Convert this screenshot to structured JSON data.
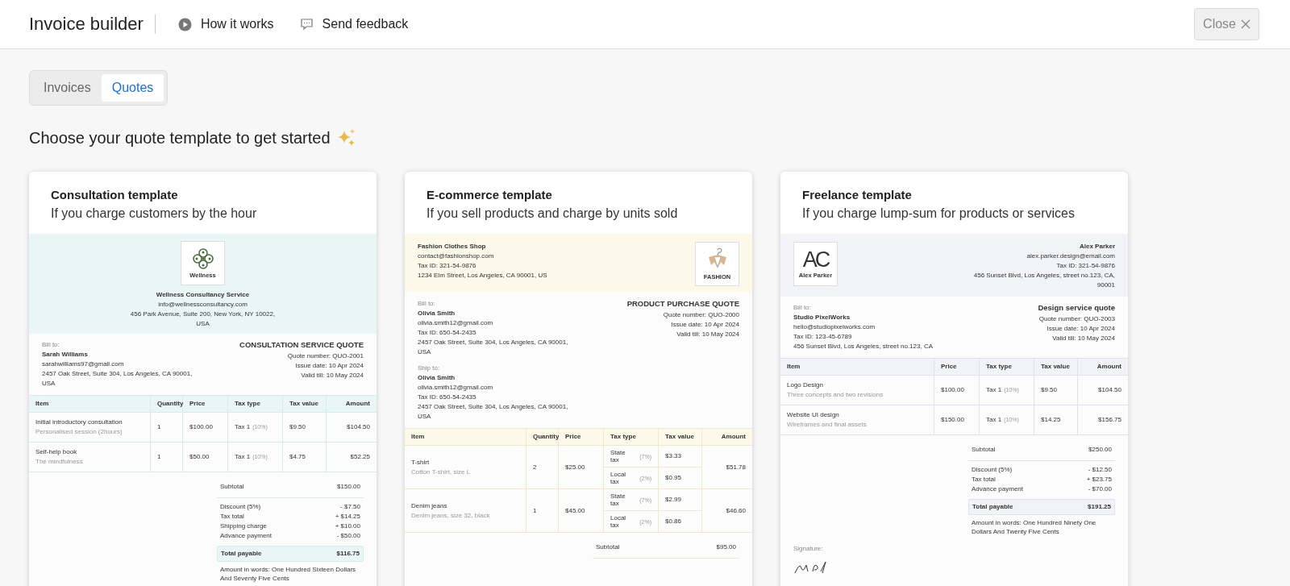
{
  "header": {
    "title": "Invoice builder",
    "links": [
      {
        "kind": "video",
        "label": "How it works"
      },
      {
        "kind": "feedback",
        "label": "Send feedback"
      }
    ],
    "close": "Close"
  },
  "tabs": [
    {
      "label": "Invoices",
      "selected": false
    },
    {
      "label": "Quotes",
      "selected": true
    }
  ],
  "heading": "Choose your quote template to get started",
  "templates": [
    {
      "kind": "consultation",
      "title": "Consultation template",
      "subtitle": "If you charge customers by the hour",
      "logo": {
        "label": "Wellness"
      },
      "sender": {
        "name": "Wellness Consultancy Service",
        "lines": [
          "info@wellnessconsultancy.com",
          "456 Park Avenue, Suite 200, New York, NY 10022, USA"
        ]
      },
      "parties": [
        {
          "label": "Bill to:",
          "name": "Sarah Williams",
          "lines": [
            "sarahwilliams97@gmail.com",
            "2457 Oak Street, Suite 304, Los Angeles, CA 90001, USA"
          ]
        }
      ],
      "quote": {
        "title": "CONSULTATION SERVICE QUOTE",
        "lines": [
          "Quote number: QUO-2001",
          "Issue date: 10 Apr 2024",
          "Valid till: 10 May 2024"
        ]
      },
      "table": {
        "columns": [
          {
            "kind": "item",
            "label": "Item"
          },
          {
            "kind": "quantity",
            "label": "Quantity"
          },
          {
            "kind": "price",
            "label": "Price"
          },
          {
            "kind": "tax_type",
            "label": "Tax type"
          },
          {
            "kind": "tax_value",
            "label": "Tax value"
          },
          {
            "kind": "amount",
            "label": "Amount"
          }
        ],
        "rows": [
          {
            "item": "Initial introductory consultation",
            "description": "Personalised session (2hours)",
            "quantity": "1",
            "price": "$100.00",
            "taxes": [
              {
                "type": "Tax 1",
                "rate": "(10%)",
                "value": "$9.50"
              }
            ],
            "amount": "$104.50"
          },
          {
            "item": "Self-help book",
            "description": "The mindfulness",
            "quantity": "1",
            "price": "$50.00",
            "taxes": [
              {
                "type": "Tax 1",
                "rate": "(10%)",
                "value": "$4.75"
              }
            ],
            "amount": "$52.25"
          }
        ]
      },
      "summary": {
        "subtotal": {
          "label": "Subtotal",
          "value": "$150.00"
        },
        "adjustments": [
          {
            "label": "Discount (5%)",
            "value": "- $7.50"
          },
          {
            "label": "Tax total",
            "value": "+ $14.25"
          },
          {
            "label": "Shipping charge",
            "value": "+ $10.00"
          },
          {
            "label": "Advance payment",
            "value": "- $50.00"
          }
        ],
        "total": {
          "label": "Total payable",
          "value": "$116.75"
        },
        "words": "Amount in words: One Hundred Sixteen Dollars And Seventy Five Cents"
      }
    },
    {
      "kind": "ecommerce",
      "title": "E-commerce template",
      "subtitle": "If you sell products and charge by units sold",
      "logo": {
        "label": "FASHION"
      },
      "sender": {
        "name": "Fashion Clothes Shop",
        "lines": [
          "contact@fashionshop.com",
          "Tax ID: 321-54-9876",
          "1234 Elm Street, Los Angeles, CA 90001, US"
        ]
      },
      "parties": [
        {
          "label": "Bill to:",
          "name": "Olivia Smith",
          "lines": [
            "olivia.smith12@gmail.com",
            "Tax ID: 650-54-2435",
            "2457 Oak Street, Suite 304, Los Angeles, CA 90001, USA"
          ]
        },
        {
          "label": "Ship to:",
          "name": "Olivia Smith",
          "lines": [
            "olivia.smith12@gmail.com",
            "Tax ID: 650-54-2435",
            "2457 Oak Street, Suite 304, Los Angeles, CA 90001, USA"
          ]
        }
      ],
      "quote": {
        "title": "PRODUCT PURCHASE QUOTE",
        "lines": [
          "Quote number: QUO-2000",
          "Issue date: 10 Apr 2024",
          "Valid till: 10 May 2024"
        ]
      },
      "table": {
        "columns": [
          {
            "kind": "item",
            "label": "Item"
          },
          {
            "kind": "quantity",
            "label": "Quantity"
          },
          {
            "kind": "price",
            "label": "Price"
          },
          {
            "kind": "tax_type",
            "label": "Tax type"
          },
          {
            "kind": "tax_value",
            "label": "Tax value"
          },
          {
            "kind": "amount",
            "label": "Amount"
          }
        ],
        "rows": [
          {
            "item": "T-shirt",
            "description": "Cotton T-shirt, size L",
            "quantity": "2",
            "price": "$25.00",
            "taxes": [
              {
                "type": "State tax",
                "rate": "(7%)",
                "value": "$3.33"
              },
              {
                "type": "Local tax",
                "rate": "(2%)",
                "value": "$0.95"
              }
            ],
            "amount": "$51.78"
          },
          {
            "item": "Denim jeans",
            "description": "Denim jeans, size 32, black",
            "quantity": "1",
            "price": "$45.00",
            "taxes": [
              {
                "type": "State tax",
                "rate": "(7%)",
                "value": "$2.99"
              },
              {
                "type": "Local tax",
                "rate": "(2%)",
                "value": "$0.86"
              }
            ],
            "amount": "$46.60"
          }
        ]
      },
      "summary": {
        "subtotal": {
          "label": "Subtotal",
          "value": "$95.00"
        }
      }
    },
    {
      "kind": "freelance",
      "title": "Freelance template",
      "subtitle": "If you charge lump-sum for products or services",
      "logo": {
        "mark": "AC",
        "label": "Alex Parker"
      },
      "sender": {
        "name": "Alex Parker",
        "lines": [
          "alex.parker.design@email.com",
          "Tax ID: 321-54-9876",
          "456 Sunset Blvd, Los Angeles, street no.123, CA, 90001"
        ]
      },
      "parties": [
        {
          "label": "Bill to:",
          "name": "Studio PixelWorks",
          "lines": [
            "hello@studiopixelworks.com",
            "Tax ID: 123-45-6789",
            "456 Sunset Blvd, Los Angeles, street no.123, CA"
          ]
        }
      ],
      "quote": {
        "title": "Design service quote",
        "lines": [
          "Quote number: QUO-2003",
          "Issue date: 10 Apr 2024",
          "Valid till: 10 May 2024"
        ]
      },
      "table": {
        "columns": [
          {
            "kind": "item",
            "label": "Item"
          },
          {
            "kind": "price",
            "label": "Price"
          },
          {
            "kind": "tax_type",
            "label": "Tax type"
          },
          {
            "kind": "tax_value",
            "label": "Tax value"
          },
          {
            "kind": "amount",
            "label": "Amount"
          }
        ],
        "rows": [
          {
            "item": "Logo Design",
            "description": "Three concepts and two revisions",
            "price": "$100.00",
            "taxes": [
              {
                "type": "Tax 1",
                "rate": "(10%)",
                "value": "$9.50"
              }
            ],
            "amount": "$104.50"
          },
          {
            "item": "Website UI design",
            "description": "Wireframes and final assets",
            "price": "$150.00",
            "taxes": [
              {
                "type": "Tax 1",
                "rate": "(10%)",
                "value": "$14.25"
              }
            ],
            "amount": "$156.75"
          }
        ]
      },
      "summary": {
        "subtotal": {
          "label": "Subtotal",
          "value": "$250.00"
        },
        "adjustments": [
          {
            "label": "Discount (5%)",
            "value": "- $12.50"
          },
          {
            "label": "Tax total",
            "value": "+ $23.75"
          },
          {
            "label": "Advance payment",
            "value": "- $70.00"
          }
        ],
        "total": {
          "label": "Total payable",
          "value": "$191.25"
        },
        "words": "Amount in words: One Hundred Ninety One Dollars And Twenty Five Cents"
      },
      "signature": {
        "label": "Signature:"
      }
    }
  ]
}
